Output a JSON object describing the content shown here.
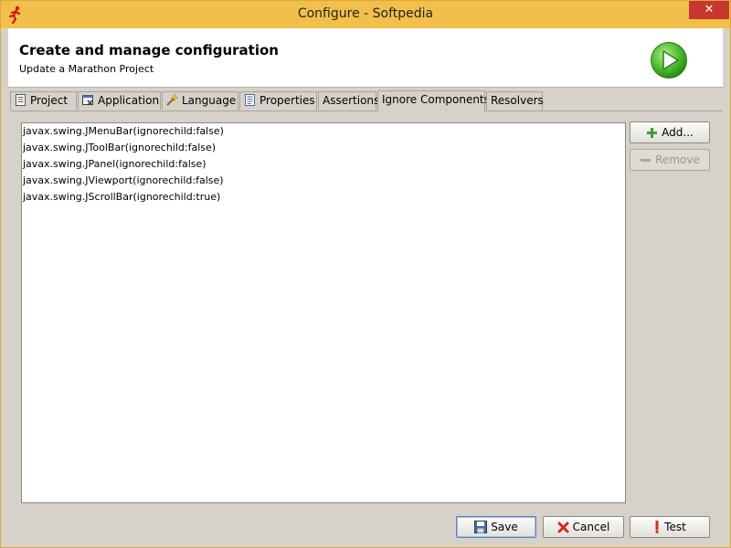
{
  "window": {
    "title": "Configure - Softpedia",
    "close_label": "✕"
  },
  "header": {
    "title": "Create and manage configuration",
    "subtitle": "Update a Marathon Project"
  },
  "tabs": [
    {
      "label": "Project",
      "icon": "document-icon"
    },
    {
      "label": "Application",
      "icon": "application-icon"
    },
    {
      "label": "Language",
      "icon": "magic-wand-icon"
    },
    {
      "label": "Properties",
      "icon": "properties-icon"
    },
    {
      "label": "Assertions"
    },
    {
      "label": "Ignore Components",
      "active": true
    },
    {
      "label": "Resolvers"
    }
  ],
  "ignore_list": [
    "javax.swing.JMenuBar(ignorechild:false)",
    "javax.swing.JToolBar(ignorechild:false)",
    "javax.swing.JPanel(ignorechild:false)",
    "javax.swing.JViewport(ignorechild:false)",
    "javax.swing.JScrollBar(ignorechild:true)"
  ],
  "side_buttons": {
    "add": "Add...",
    "remove": "Remove"
  },
  "footer_buttons": {
    "save": "Save",
    "cancel": "Cancel",
    "test": "Test"
  },
  "colors": {
    "titlebar": "#f2c04a",
    "close": "#c7372f",
    "play_icon": "#3caa2c"
  }
}
